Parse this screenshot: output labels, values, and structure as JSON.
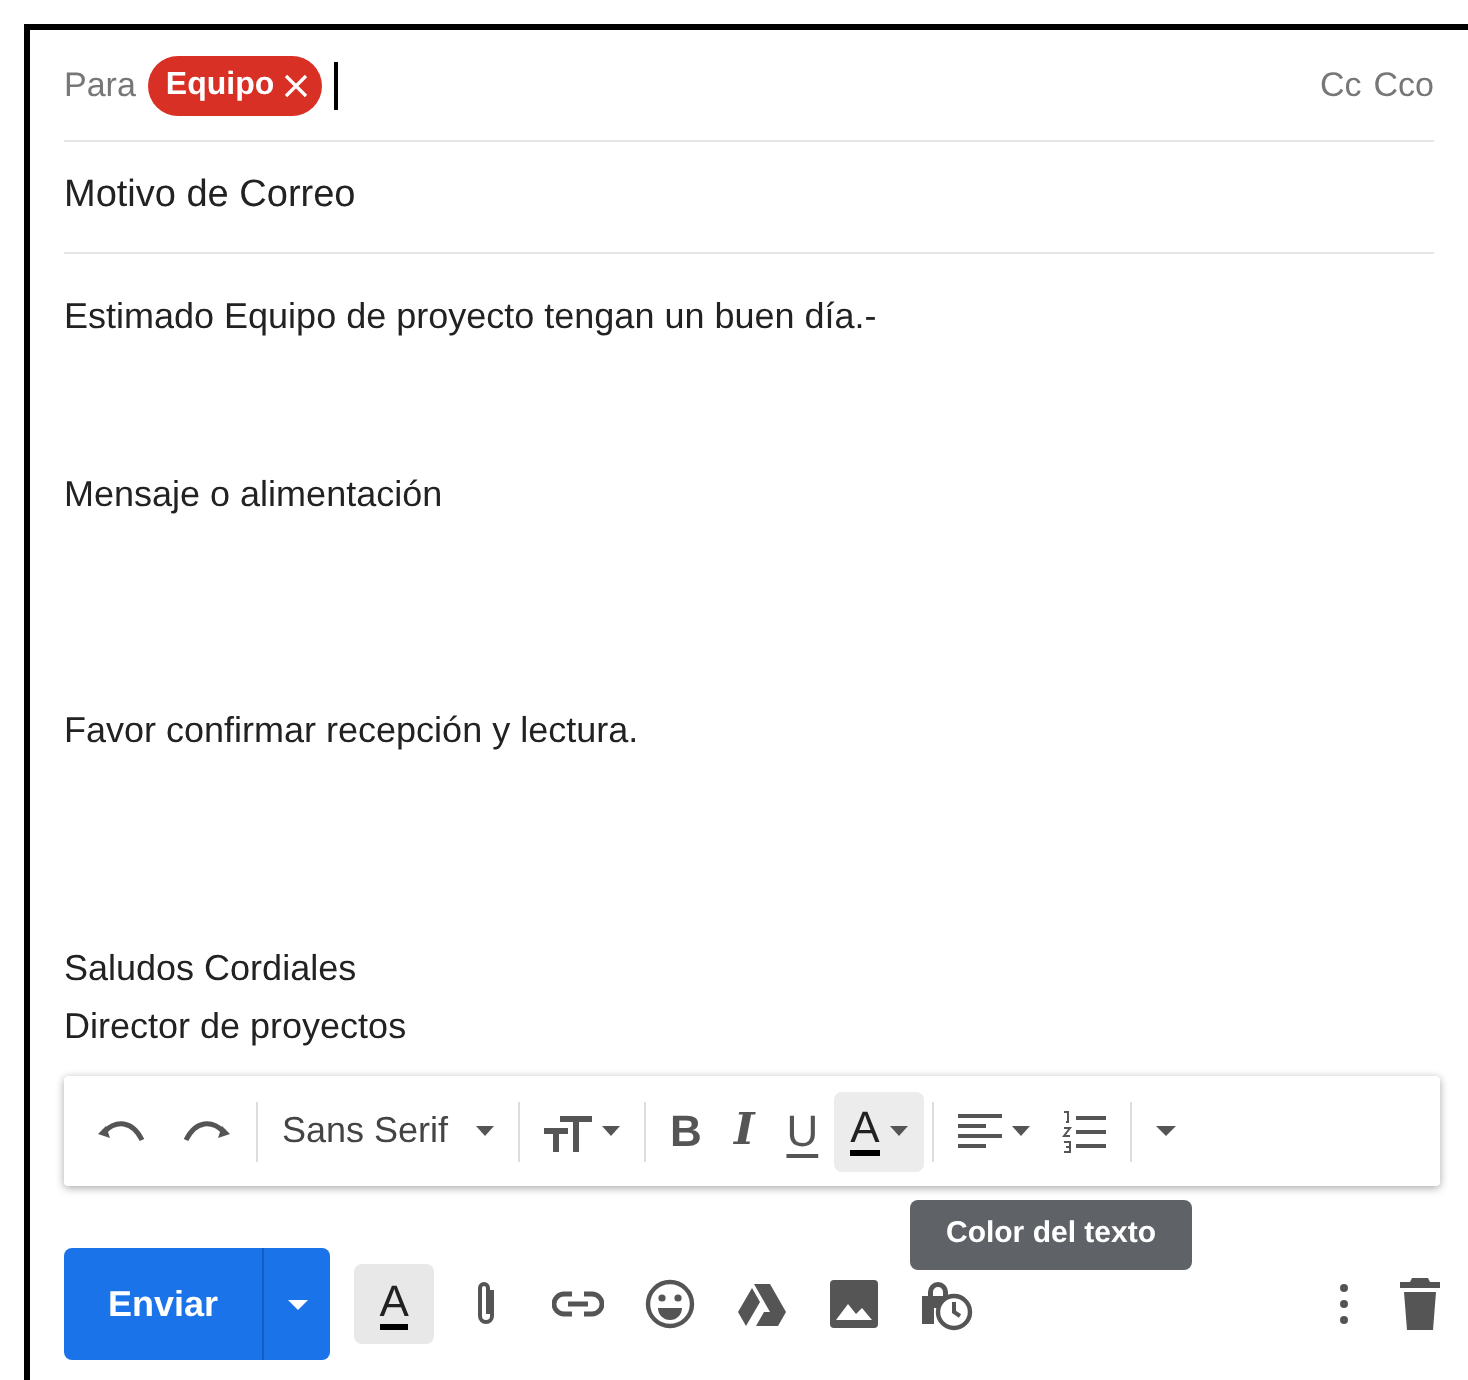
{
  "to": {
    "label": "Para",
    "recipients": [
      {
        "name": "Equipo"
      }
    ],
    "cc_links": [
      "Cc",
      "Cco"
    ]
  },
  "subject": {
    "value": "Motivo de Correo"
  },
  "body": [
    "Estimado Equipo de proyecto tengan un buen día.-",
    "Mensaje o alimentación",
    "Favor confirmar recepción y lectura.",
    "Saludos Cordiales",
    "Director de proyectos"
  ],
  "format_toolbar": [
    {
      "kind": "undo",
      "highlighted": false
    },
    {
      "kind": "redo",
      "highlighted": false
    },
    {
      "kind": "font",
      "label": "Sans Serif",
      "highlighted": false
    },
    {
      "kind": "size",
      "highlighted": false
    },
    {
      "kind": "bold",
      "label": "B",
      "highlighted": false
    },
    {
      "kind": "italic",
      "label": "I",
      "highlighted": false
    },
    {
      "kind": "underline",
      "label": "U",
      "highlighted": false
    },
    {
      "kind": "color",
      "label": "A",
      "highlighted": true
    },
    {
      "kind": "align",
      "highlighted": false
    },
    {
      "kind": "list",
      "highlighted": false
    },
    {
      "kind": "more",
      "highlighted": false
    }
  ],
  "tooltip": "Color del texto",
  "send_button": "Enviar",
  "bottom_tools": [
    {
      "kind": "format",
      "label": "A",
      "highlighted": true
    },
    {
      "kind": "attach",
      "highlighted": false
    },
    {
      "kind": "link",
      "highlighted": false
    },
    {
      "kind": "emoji",
      "highlighted": false
    },
    {
      "kind": "drive",
      "highlighted": false
    },
    {
      "kind": "photo",
      "highlighted": false
    },
    {
      "kind": "confidential",
      "highlighted": false
    }
  ]
}
